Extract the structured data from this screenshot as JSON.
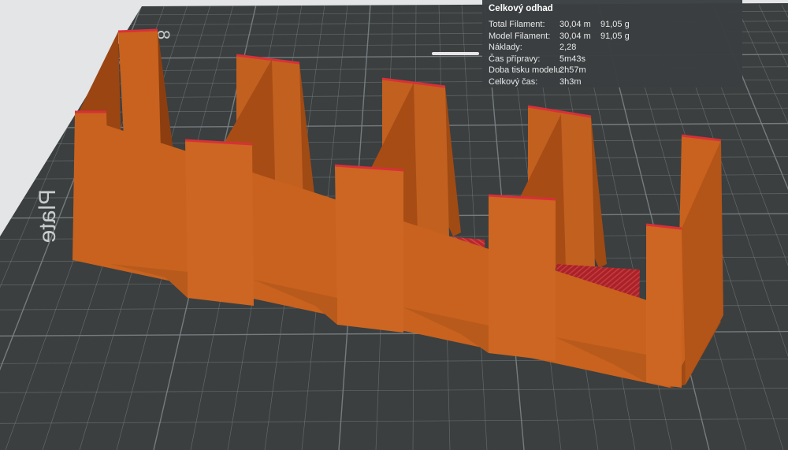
{
  "plate": {
    "label": "Plate"
  },
  "estimate": {
    "title": "Celkový odhad",
    "rows": [
      {
        "key": "Total Filament:",
        "length": "30,04 m",
        "weight": "91,05 g"
      },
      {
        "key": "Model Filament:",
        "length": "30,04 m",
        "weight": "91,05 g"
      },
      {
        "key": "Náklady:",
        "value": "2,28"
      },
      {
        "key": "Čas přípravy:",
        "value": "5m43s"
      },
      {
        "key": "Doba tisku modelu:",
        "value": "2h57m"
      },
      {
        "key": "Celkový čas:",
        "value": "3h3m"
      }
    ]
  },
  "colors": {
    "background": "#e3e5e6",
    "plate": "#3b3f40",
    "grid": "#7d8284",
    "model_body": "#c8621e",
    "model_shadow": "#8c3e10",
    "infill": "#b8262c",
    "panel": "#3a3e40"
  }
}
